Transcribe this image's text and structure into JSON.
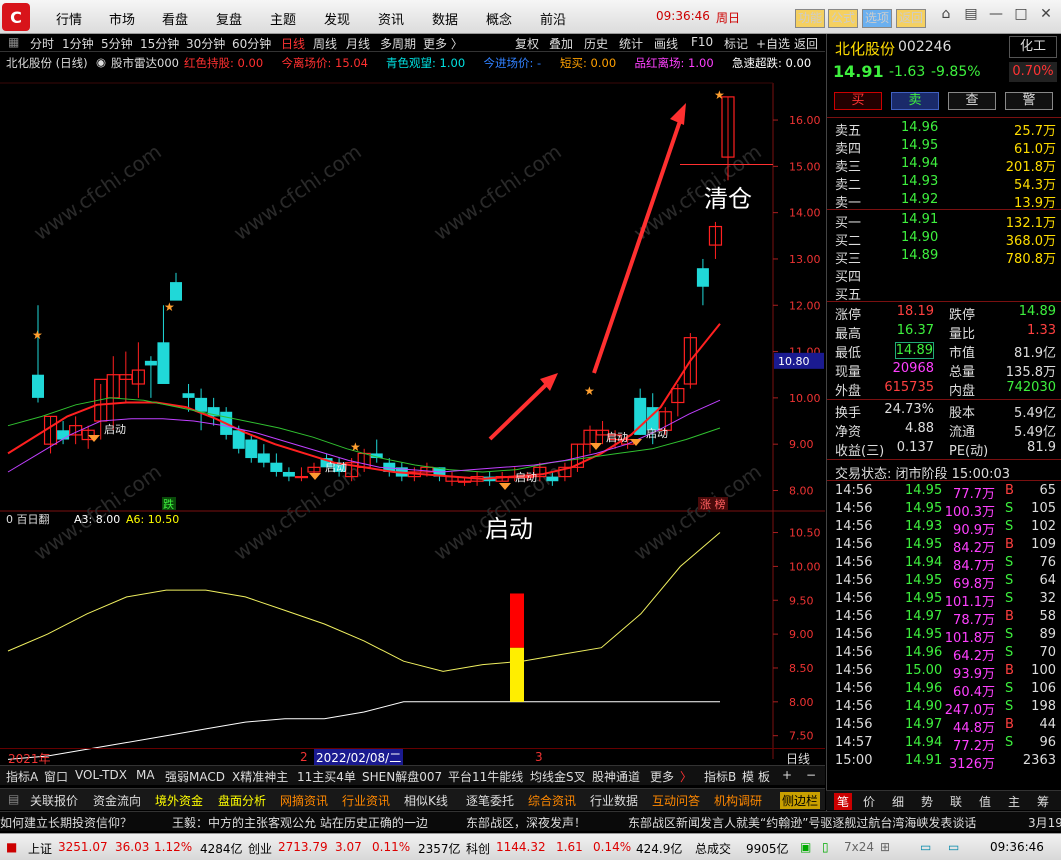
{
  "menu": {
    "items": [
      "行情",
      "市场",
      "看盘",
      "复盘",
      "主题",
      "发现",
      "资讯",
      "数据",
      "概念",
      "前沿"
    ],
    "clock": "09:36:46",
    "weekday": "周日",
    "func_buttons": [
      "功能",
      "公式",
      "选项",
      "返回"
    ]
  },
  "toolbar": {
    "periods": [
      "分时",
      "1分钟",
      "5分钟",
      "15分钟",
      "30分钟",
      "60分钟",
      "日线",
      "周线",
      "月线",
      "多周期",
      "更多 〉"
    ],
    "active_period": "日线",
    "tools": [
      "复权",
      "叠加",
      "历史",
      "统计",
      "画线",
      "F10",
      "标记",
      "+自选",
      "返回"
    ]
  },
  "info": {
    "stock": "北化股份 (日线)",
    "indicator": "股市雷达000",
    "items": [
      {
        "label": "红色持股:",
        "value": "0.00",
        "color": "#ff3030"
      },
      {
        "label": "今离场价:",
        "value": "15.04",
        "color": "#ff3030"
      },
      {
        "label": "青色观望:",
        "value": "1.00",
        "color": "#00e0e0"
      },
      {
        "label": "今进场价:",
        "value": "-",
        "color": "#3080ff"
      },
      {
        "label": "短买:",
        "value": "0.00",
        "color": "#ffa000"
      },
      {
        "label": "品红离场:",
        "value": "1.00",
        "color": "#ff40ff"
      },
      {
        "label": "急速超跌:",
        "value": "0.00",
        "color": "#ffffff"
      }
    ]
  },
  "chart_data": [
    {
      "type": "candlestick",
      "title": "北化股份 (日线)",
      "ylim": [
        7.6,
        16.8
      ],
      "yticks": [
        "16.00",
        "15.00",
        "14.00",
        "13.00",
        "12.00",
        "11.00",
        "10.00",
        "9.00",
        "8.00"
      ],
      "last_price_label": "10.80",
      "x": [
        "2021年",
        "2",
        "2022/02/08/二",
        "3"
      ],
      "ohlc": [
        [
          10.5,
          12.0,
          9.9,
          10.0
        ],
        [
          9.0,
          9.6,
          8.8,
          9.6
        ],
        [
          9.3,
          9.5,
          9.0,
          9.1
        ],
        [
          9.2,
          9.6,
          9.0,
          9.4
        ],
        [
          9.1,
          9.4,
          8.9,
          9.3
        ],
        [
          9.5,
          10.3,
          9.1,
          10.4
        ],
        [
          10.0,
          10.9,
          9.3,
          10.5
        ],
        [
          10.4,
          11.0,
          9.9,
          10.5
        ],
        [
          10.3,
          11.2,
          10.0,
          10.6
        ],
        [
          10.8,
          10.9,
          10.0,
          10.7
        ],
        [
          11.2,
          12.0,
          10.5,
          10.3
        ],
        [
          12.5,
          12.7,
          12.2,
          12.1
        ],
        [
          10.1,
          10.3,
          9.7,
          10.0
        ],
        [
          10.0,
          10.2,
          9.3,
          9.7
        ],
        [
          9.8,
          10.0,
          9.4,
          9.6
        ],
        [
          9.7,
          9.8,
          9.1,
          9.2
        ],
        [
          9.3,
          9.4,
          8.8,
          8.9
        ],
        [
          9.1,
          9.2,
          8.6,
          8.7
        ],
        [
          8.8,
          9.0,
          8.5,
          8.6
        ],
        [
          8.6,
          8.8,
          8.3,
          8.4
        ],
        [
          8.4,
          8.5,
          8.2,
          8.3
        ],
        [
          8.3,
          8.5,
          8.2,
          8.3
        ],
        [
          8.4,
          8.6,
          8.3,
          8.5
        ],
        [
          8.7,
          8.8,
          8.5,
          8.5
        ],
        [
          8.6,
          8.7,
          8.3,
          8.4
        ],
        [
          8.3,
          8.7,
          8.2,
          8.6
        ],
        [
          8.5,
          8.9,
          8.4,
          8.8
        ],
        [
          8.8,
          9.1,
          8.6,
          8.7
        ],
        [
          8.6,
          8.7,
          8.3,
          8.4
        ],
        [
          8.5,
          8.6,
          8.2,
          8.3
        ],
        [
          8.3,
          8.5,
          8.2,
          8.4
        ],
        [
          8.4,
          8.6,
          8.3,
          8.5
        ],
        [
          8.5,
          8.5,
          8.2,
          8.3
        ],
        [
          8.2,
          8.4,
          8.1,
          8.3
        ],
        [
          8.2,
          8.3,
          8.1,
          8.2
        ],
        [
          8.2,
          8.4,
          8.1,
          8.3
        ],
        [
          8.3,
          8.4,
          8.1,
          8.2
        ],
        [
          8.2,
          8.4,
          8.2,
          8.3
        ],
        [
          8.3,
          8.5,
          8.2,
          8.3
        ],
        [
          8.3,
          8.4,
          8.2,
          8.3
        ],
        [
          8.3,
          8.6,
          8.2,
          8.5
        ],
        [
          8.3,
          8.4,
          8.1,
          8.2
        ],
        [
          8.3,
          8.6,
          8.2,
          8.5
        ],
        [
          8.5,
          9.0,
          8.4,
          9.0
        ],
        [
          9.0,
          9.4,
          8.8,
          9.3
        ],
        [
          9.2,
          9.5,
          9.0,
          9.3
        ],
        [
          9.1,
          9.3,
          8.9,
          9.2
        ],
        [
          9.0,
          9.2,
          8.9,
          9.1
        ],
        [
          10.0,
          10.2,
          9.2,
          9.2
        ],
        [
          9.8,
          10.1,
          9.0,
          9.3
        ],
        [
          9.3,
          9.8,
          9.2,
          9.7
        ],
        [
          9.9,
          10.3,
          9.6,
          10.2
        ],
        [
          10.3,
          11.4,
          10.2,
          11.3
        ],
        [
          12.8,
          13.0,
          12.0,
          12.4
        ],
        [
          13.3,
          13.8,
          13.0,
          13.7
        ],
        [
          15.2,
          16.5,
          14.7,
          16.5
        ]
      ],
      "ma_lines": [
        {
          "name": "MA-red",
          "color": "#ff2020",
          "values": [
            8.8,
            9.2,
            9.6,
            9.85,
            9.9,
            9.9,
            9.8,
            9.55,
            9.25,
            9.0,
            8.8,
            8.6,
            8.5,
            8.4,
            8.35,
            8.3,
            8.25,
            8.3,
            8.35,
            8.5,
            8.8,
            9.2,
            9.8,
            10.8,
            11.6
          ]
        },
        {
          "name": "MA-green",
          "color": "#30c030",
          "values": [
            9.4,
            9.6,
            9.85,
            10.0,
            9.95,
            9.8,
            9.65,
            9.5,
            9.35,
            9.15,
            8.9,
            8.7,
            8.55,
            8.45,
            8.4,
            8.45,
            8.6,
            8.7,
            8.8,
            8.9,
            9.1,
            9.35
          ]
        },
        {
          "name": "MA-purple",
          "color": "#c040ff",
          "values": [
            8.4,
            8.8,
            9.2,
            9.5,
            9.55,
            9.55,
            9.5,
            9.4,
            9.25,
            9.05,
            8.85,
            8.65,
            8.5,
            8.45,
            8.4,
            8.45,
            8.5,
            8.55,
            8.65,
            8.8,
            9.0,
            9.3,
            9.65,
            9.95
          ]
        }
      ],
      "annotations": [
        "启动",
        "启动",
        "启动",
        "启动",
        "启动",
        "跌",
        "涨 榜",
        "清仓"
      ]
    },
    {
      "type": "line",
      "title": "百日翻",
      "legend": [
        "A3: 8.00",
        "A6: 10.50"
      ],
      "ylim": [
        7.2,
        10.7
      ],
      "yticks": [
        "10.50",
        "10.00",
        "9.50",
        "9.00",
        "8.50",
        "8.00",
        "7.50"
      ],
      "series": [
        {
          "name": "A3",
          "color": "#ffffff",
          "values": [
            7.15,
            7.2,
            7.3,
            7.4,
            7.5,
            7.6,
            7.7,
            7.75,
            7.75,
            7.85,
            8.0,
            8.0,
            8.0,
            8.0,
            8.0,
            8.0,
            8.0,
            8.0,
            8.0
          ]
        },
        {
          "name": "A6",
          "color": "#f0f060",
          "values": [
            8.75,
            9.0,
            9.3,
            9.55,
            9.65,
            9.65,
            9.55,
            9.35,
            9.15,
            8.9,
            8.6,
            8.45,
            8.55,
            8.6,
            8.7,
            8.8,
            9.3,
            10.0,
            10.5
          ]
        }
      ],
      "bars": [
        {
          "color": "#ffee00",
          "bottom": 8.0,
          "top": 8.8
        },
        {
          "color": "#ff0000",
          "bottom": 8.8,
          "top": 9.6
        }
      ],
      "annotation": "启动"
    }
  ],
  "chart_labels": {
    "qingcang": "清仓",
    "qidong_big": "启动",
    "qidong": "启动",
    "die": "跌",
    "zhangbang": "涨 榜",
    "sub_title": "0 百日翻",
    "sub_a3": "A3: 8.00",
    "sub_a6": "A6: 10.50"
  },
  "xaxis": {
    "year": "2021年",
    "m2": "2",
    "date": "2022/02/08/二",
    "m3": "3",
    "period": "日线"
  },
  "tabs1": [
    "指标A",
    "窗口",
    "VOL-TDX",
    "MA",
    "强弱MACD",
    "X精准神主",
    "11主买4单",
    "SHEN解盘007",
    "平台11牛能线",
    "均线金S叉",
    "股神通道",
    "更多",
    "〉",
    "指标B",
    "模",
    "板",
    "+",
    "−"
  ],
  "tabs2": [
    "关联报价",
    "资金流向",
    "境外资金",
    "盘面分析",
    "网摘资讯",
    "行业资讯",
    "相似K线",
    "逐笔委托",
    "综合资讯",
    "行业数据",
    "互动问答",
    "机构调研",
    "侧边栏"
  ],
  "ticker": [
    "如何建立长期投资信仰？",
    "王毅：中方的主张客观公允 站在历史正确的一边",
    "东部战区，深夜发声！",
    "东部战区新闻发言人就美“约翰逊”号驱逐舰过航台湾海峡发表谈话",
    "3月19"
  ],
  "status": {
    "sh_label": "上证",
    "sh_val": "3251.07",
    "sh_chg": "36.03",
    "sh_pct": "1.12%",
    "sh_amt": "4284亿",
    "cy_label": "创业",
    "cy_val": "2713.79",
    "cy_chg": "3.07",
    "cy_pct": "0.11%",
    "cy_amt": "2357亿",
    "kc_label": "科创",
    "kc_val": "1144.32",
    "kc_chg": "1.61",
    "kc_pct": "0.14%",
    "kc_amt": "424.9亿",
    "total_label": "总成交",
    "total_val": "9905亿",
    "extra": "7x24",
    "clock": "09:36:46"
  },
  "quote": {
    "name": "北化股份",
    "code": "002246",
    "sector": "化工",
    "price": "14.91",
    "change": "-1.63",
    "pct": "-9.85%",
    "turnover_badge": "0.70%",
    "buttons": [
      "买",
      "卖",
      "查",
      "警"
    ],
    "asks": [
      {
        "l": "卖五",
        "p": "14.96",
        "v": "25.7万"
      },
      {
        "l": "卖四",
        "p": "14.95",
        "v": "61.0万"
      },
      {
        "l": "卖三",
        "p": "14.94",
        "v": "201.8万"
      },
      {
        "l": "卖二",
        "p": "14.93",
        "v": "54.3万"
      },
      {
        "l": "卖一",
        "p": "14.92",
        "v": "13.9万"
      }
    ],
    "bids": [
      {
        "l": "买一",
        "p": "14.91",
        "v": "132.1万"
      },
      {
        "l": "买二",
        "p": "14.90",
        "v": "368.0万"
      },
      {
        "l": "买三",
        "p": "14.89",
        "v": "780.8万"
      },
      {
        "l": "买四",
        "p": "",
        "v": ""
      },
      {
        "l": "买五",
        "p": "",
        "v": ""
      }
    ],
    "stats": [
      {
        "l1": "涨停",
        "v1": "18.19",
        "l2": "跌停",
        "v2": "14.89"
      },
      {
        "l1": "最高",
        "v1": "16.37",
        "l2": "量比",
        "v2": "1.33"
      },
      {
        "l1": "最低",
        "v1": "14.89",
        "l2": "市值",
        "v2": "81.9亿"
      },
      {
        "l1": "现量",
        "v1": "20968",
        "l2": "总量",
        "v2": "135.8万"
      },
      {
        "l1": "外盘",
        "v1": "615735",
        "l2": "内盘",
        "v2": "742030"
      }
    ],
    "stats2": [
      {
        "l1": "换手",
        "v1": "24.73%",
        "l2": "股本",
        "v2": "5.49亿"
      },
      {
        "l1": "净资",
        "v1": "4.88",
        "l2": "流通",
        "v2": "5.49亿"
      },
      {
        "l1": "收益(三)",
        "v1": "0.137",
        "l2": "PE(动)",
        "v2": "81.9"
      }
    ],
    "trade_state": "交易状态: 闭市阶段 15:00:03",
    "ticks": [
      [
        "14:56",
        "14.95",
        "77.7万",
        "B",
        "65"
      ],
      [
        "14:56",
        "14.95",
        "100.3万",
        "S",
        "105"
      ],
      [
        "14:56",
        "14.93",
        "90.9万",
        "S",
        "102"
      ],
      [
        "14:56",
        "14.95",
        "84.2万",
        "B",
        "109"
      ],
      [
        "14:56",
        "14.94",
        "84.7万",
        "S",
        "76"
      ],
      [
        "14:56",
        "14.95",
        "69.8万",
        "S",
        "64"
      ],
      [
        "14:56",
        "14.95",
        "101.1万",
        "S",
        "32"
      ],
      [
        "14:56",
        "14.97",
        "78.7万",
        "B",
        "58"
      ],
      [
        "14:56",
        "14.95",
        "101.8万",
        "S",
        "89"
      ],
      [
        "14:56",
        "14.96",
        "64.2万",
        "S",
        "70"
      ],
      [
        "14:56",
        "15.00",
        "93.9万",
        "B",
        "100"
      ],
      [
        "14:56",
        "14.96",
        "60.4万",
        "S",
        "106"
      ],
      [
        "14:56",
        "14.90",
        "247.0万",
        "S",
        "198"
      ],
      [
        "14:56",
        "14.97",
        "44.8万",
        "B",
        "44"
      ],
      [
        "14:57",
        "14.94",
        "77.2万",
        "S",
        "96"
      ],
      [
        "15:00",
        "14.91",
        "3126万",
        "",
        "2363"
      ]
    ],
    "bottom_tabs": [
      "笔",
      "价",
      "细",
      "势",
      "联",
      "值",
      "主",
      "筹"
    ]
  },
  "watermark": "www.cfchi.com"
}
